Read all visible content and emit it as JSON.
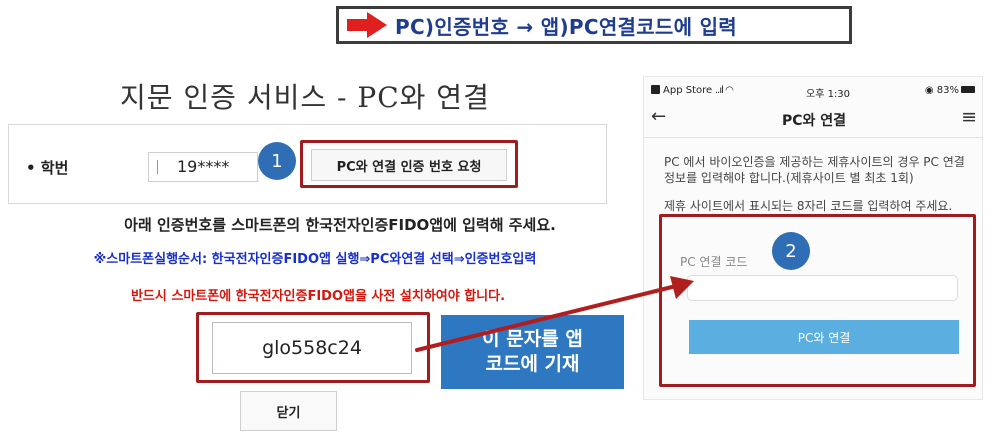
{
  "banner": {
    "text": "PC)인증번호 → 앱)PC연결코드에 입력",
    "arrow_color": "#e01f1f",
    "text_color": "#1f3d8f"
  },
  "left_panel": {
    "title": "지문 인증 서비스 - PC와 연결",
    "student_id_label": "• 학번",
    "student_id_value": "19****",
    "request_button": "PC와 연결 인증 번호 요청",
    "instruction": "아래 인증번호를 스마트폰의 한국전자인증FIDO앱에 입력해 주세요.",
    "order_note": "※스마트폰실행순서: 한국전자인증FIDO앱 실행⇒PC와연결 선택⇒인증번호입력",
    "must_install_note": "반드시 스마트폰에 한국전자인증FIDO앱을 사전 설치하여야 합니다.",
    "auth_code": "glo558c24",
    "close_button": "닫기"
  },
  "badges": {
    "step1": "1",
    "step2": "2"
  },
  "callout": {
    "line1": "이 문자를 앱",
    "line2": "코드에 기재"
  },
  "phone": {
    "status": {
      "carrier": "App Store",
      "signal": "..ıl ",
      "time": "오후 1:30",
      "battery": "83%"
    },
    "nav": {
      "back_icon": "←",
      "title": "PC와 연결",
      "menu_icon": "≡"
    },
    "description": "PC 에서 바이오인증을 제공하는 제휴사이트의 경우 PC 연결 정보를 입력해야 합니다.(제휴사이트 별 최초 1회)",
    "description2": "제휴 사이트에서 표시되는 8자리 코드를 입력하여 주세요.",
    "code_label": "PC 연결 코드",
    "code_value": "",
    "connect_button": "PC와 연결"
  },
  "colors": {
    "highlight_outline": "#a01c1f",
    "badge_blue": "#2f6db5",
    "callout_blue": "#2e78c2",
    "order_blue": "#1830c9",
    "warning_red": "#d4170d",
    "phone_button_blue": "#5aaee0",
    "connector_arrow": "#b01e1e"
  }
}
